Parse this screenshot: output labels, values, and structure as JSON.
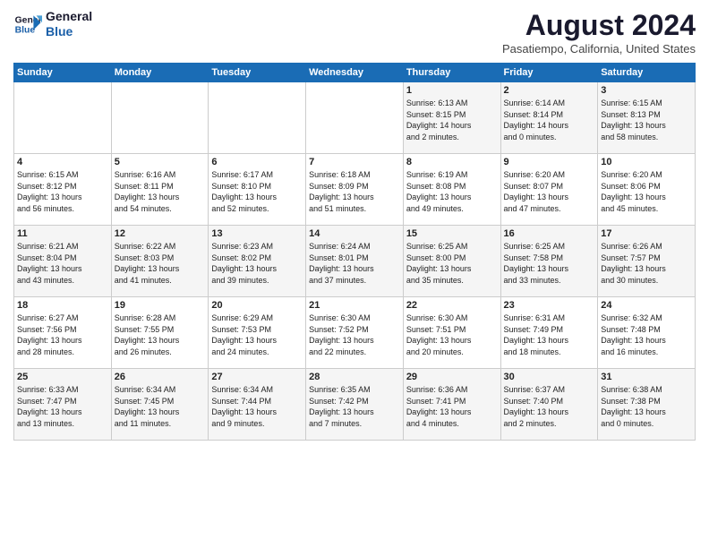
{
  "logo": {
    "line1": "General",
    "line2": "Blue"
  },
  "title": "August 2024",
  "subtitle": "Pasatiempo, California, United States",
  "weekdays": [
    "Sunday",
    "Monday",
    "Tuesday",
    "Wednesday",
    "Thursday",
    "Friday",
    "Saturday"
  ],
  "weeks": [
    [
      {
        "day": "",
        "info": ""
      },
      {
        "day": "",
        "info": ""
      },
      {
        "day": "",
        "info": ""
      },
      {
        "day": "",
        "info": ""
      },
      {
        "day": "1",
        "info": "Sunrise: 6:13 AM\nSunset: 8:15 PM\nDaylight: 14 hours\nand 2 minutes."
      },
      {
        "day": "2",
        "info": "Sunrise: 6:14 AM\nSunset: 8:14 PM\nDaylight: 14 hours\nand 0 minutes."
      },
      {
        "day": "3",
        "info": "Sunrise: 6:15 AM\nSunset: 8:13 PM\nDaylight: 13 hours\nand 58 minutes."
      }
    ],
    [
      {
        "day": "4",
        "info": "Sunrise: 6:15 AM\nSunset: 8:12 PM\nDaylight: 13 hours\nand 56 minutes."
      },
      {
        "day": "5",
        "info": "Sunrise: 6:16 AM\nSunset: 8:11 PM\nDaylight: 13 hours\nand 54 minutes."
      },
      {
        "day": "6",
        "info": "Sunrise: 6:17 AM\nSunset: 8:10 PM\nDaylight: 13 hours\nand 52 minutes."
      },
      {
        "day": "7",
        "info": "Sunrise: 6:18 AM\nSunset: 8:09 PM\nDaylight: 13 hours\nand 51 minutes."
      },
      {
        "day": "8",
        "info": "Sunrise: 6:19 AM\nSunset: 8:08 PM\nDaylight: 13 hours\nand 49 minutes."
      },
      {
        "day": "9",
        "info": "Sunrise: 6:20 AM\nSunset: 8:07 PM\nDaylight: 13 hours\nand 47 minutes."
      },
      {
        "day": "10",
        "info": "Sunrise: 6:20 AM\nSunset: 8:06 PM\nDaylight: 13 hours\nand 45 minutes."
      }
    ],
    [
      {
        "day": "11",
        "info": "Sunrise: 6:21 AM\nSunset: 8:04 PM\nDaylight: 13 hours\nand 43 minutes."
      },
      {
        "day": "12",
        "info": "Sunrise: 6:22 AM\nSunset: 8:03 PM\nDaylight: 13 hours\nand 41 minutes."
      },
      {
        "day": "13",
        "info": "Sunrise: 6:23 AM\nSunset: 8:02 PM\nDaylight: 13 hours\nand 39 minutes."
      },
      {
        "day": "14",
        "info": "Sunrise: 6:24 AM\nSunset: 8:01 PM\nDaylight: 13 hours\nand 37 minutes."
      },
      {
        "day": "15",
        "info": "Sunrise: 6:25 AM\nSunset: 8:00 PM\nDaylight: 13 hours\nand 35 minutes."
      },
      {
        "day": "16",
        "info": "Sunrise: 6:25 AM\nSunset: 7:58 PM\nDaylight: 13 hours\nand 33 minutes."
      },
      {
        "day": "17",
        "info": "Sunrise: 6:26 AM\nSunset: 7:57 PM\nDaylight: 13 hours\nand 30 minutes."
      }
    ],
    [
      {
        "day": "18",
        "info": "Sunrise: 6:27 AM\nSunset: 7:56 PM\nDaylight: 13 hours\nand 28 minutes."
      },
      {
        "day": "19",
        "info": "Sunrise: 6:28 AM\nSunset: 7:55 PM\nDaylight: 13 hours\nand 26 minutes."
      },
      {
        "day": "20",
        "info": "Sunrise: 6:29 AM\nSunset: 7:53 PM\nDaylight: 13 hours\nand 24 minutes."
      },
      {
        "day": "21",
        "info": "Sunrise: 6:30 AM\nSunset: 7:52 PM\nDaylight: 13 hours\nand 22 minutes."
      },
      {
        "day": "22",
        "info": "Sunrise: 6:30 AM\nSunset: 7:51 PM\nDaylight: 13 hours\nand 20 minutes."
      },
      {
        "day": "23",
        "info": "Sunrise: 6:31 AM\nSunset: 7:49 PM\nDaylight: 13 hours\nand 18 minutes."
      },
      {
        "day": "24",
        "info": "Sunrise: 6:32 AM\nSunset: 7:48 PM\nDaylight: 13 hours\nand 16 minutes."
      }
    ],
    [
      {
        "day": "25",
        "info": "Sunrise: 6:33 AM\nSunset: 7:47 PM\nDaylight: 13 hours\nand 13 minutes."
      },
      {
        "day": "26",
        "info": "Sunrise: 6:34 AM\nSunset: 7:45 PM\nDaylight: 13 hours\nand 11 minutes."
      },
      {
        "day": "27",
        "info": "Sunrise: 6:34 AM\nSunset: 7:44 PM\nDaylight: 13 hours\nand 9 minutes."
      },
      {
        "day": "28",
        "info": "Sunrise: 6:35 AM\nSunset: 7:42 PM\nDaylight: 13 hours\nand 7 minutes."
      },
      {
        "day": "29",
        "info": "Sunrise: 6:36 AM\nSunset: 7:41 PM\nDaylight: 13 hours\nand 4 minutes."
      },
      {
        "day": "30",
        "info": "Sunrise: 6:37 AM\nSunset: 7:40 PM\nDaylight: 13 hours\nand 2 minutes."
      },
      {
        "day": "31",
        "info": "Sunrise: 6:38 AM\nSunset: 7:38 PM\nDaylight: 13 hours\nand 0 minutes."
      }
    ]
  ]
}
